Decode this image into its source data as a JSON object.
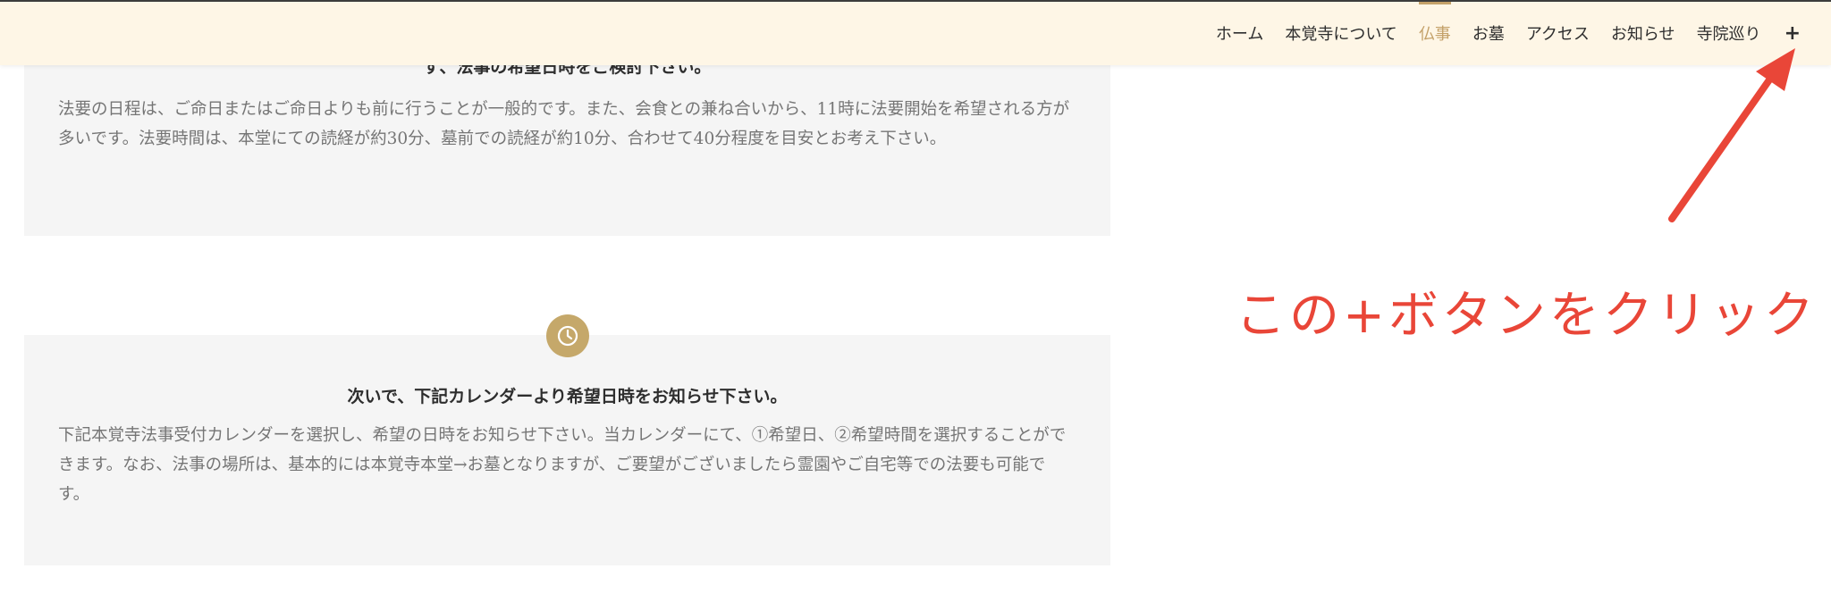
{
  "nav": {
    "items": [
      {
        "label": "ホーム"
      },
      {
        "label": "本覚寺について"
      },
      {
        "label": "仏事",
        "active": true
      },
      {
        "label": "お墓"
      },
      {
        "label": "アクセス"
      },
      {
        "label": "お知らせ"
      },
      {
        "label": "寺院巡り"
      }
    ],
    "plus_label": "+"
  },
  "sections": [
    {
      "title": "ず、法事の希望日時をご検討下さい。",
      "body": "法要の日程は、ご命日またはご命日よりも前に行うことが一般的です。また、会食との兼ね合いから、11時に法要開始を希望される方が多いです。法要時間は、本堂にての読経が約30分、墓前での読経が約10分、合わせて40分程度を目安とお考え下さい。"
    },
    {
      "title": "次いで、下記カレンダーより希望日時をお知らせ下さい。",
      "body": "下記本覚寺法事受付カレンダーを選択し、希望の日時をお知らせ下さい。当カレンダーにて、①希望日、②希望時間を選択することができます。なお、法事の場所は、基本的には本覚寺本堂→お墓となりますが、ご要望がございましたら霊園やご自宅等での法要も可能です。"
    }
  ],
  "annotation": {
    "text": "この+ボタンをクリック",
    "color": "#e94638"
  },
  "colors": {
    "nav_bg": "#fef6e6",
    "accent_gold": "#c4a169",
    "card_bg": "#f5f5f5"
  },
  "icons": {
    "section_badge": "clock-icon",
    "annotation": "arrow-icon"
  }
}
